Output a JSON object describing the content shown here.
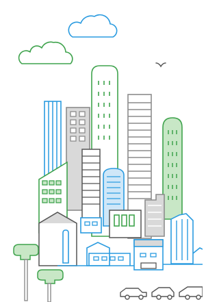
{
  "illustration": {
    "subject": "city-skyline",
    "elements": [
      "clouds",
      "bird",
      "skyscrapers",
      "houses",
      "trees",
      "cars"
    ]
  },
  "colors": {
    "blue": "#2a9be0",
    "green": "#3fa34d",
    "gray": "#8c8c8c",
    "light_gray": "#d9d9d9",
    "light_green": "#c8e7c6",
    "light_blue": "#cfe7f8",
    "background": "#ffffff"
  }
}
